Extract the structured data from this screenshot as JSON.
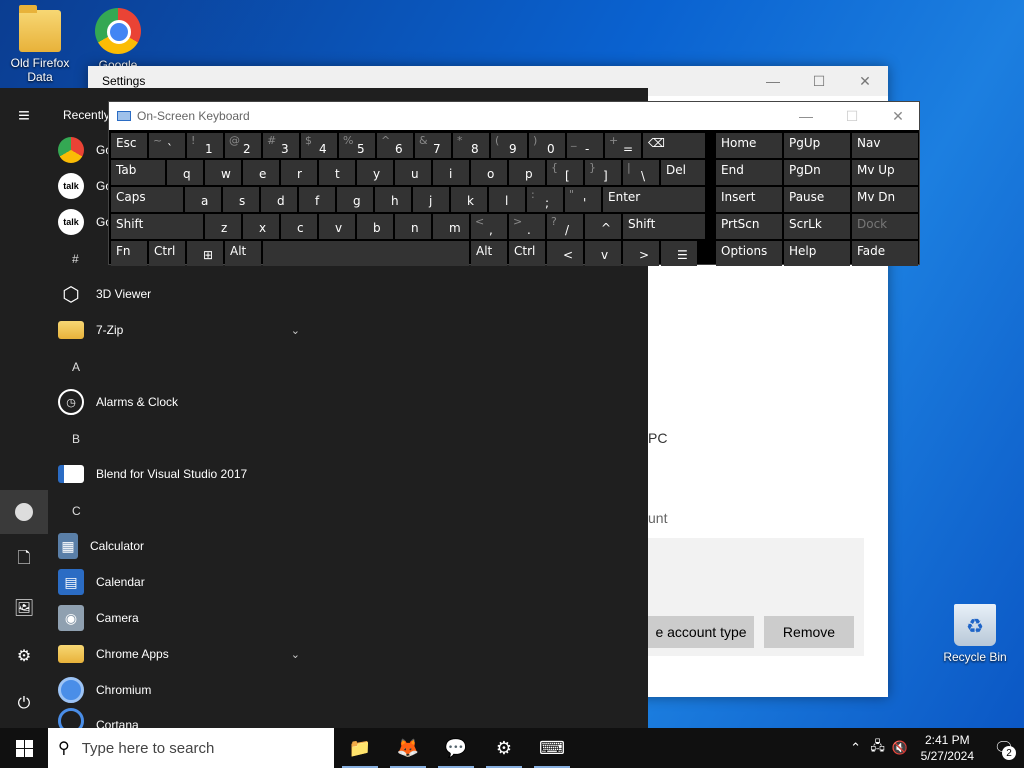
{
  "desktop": {
    "icons": [
      {
        "label": "Old Firefox Data",
        "icon": "folder-icon"
      },
      {
        "label": "Google Chrome",
        "icon": "chrome-icon"
      },
      {
        "label": "Recycle Bin",
        "icon": "recycle-bin-icon"
      }
    ]
  },
  "settings": {
    "title": "Settings",
    "frag_pc": "PC",
    "frag_unt": "unt",
    "change_type_btn": "e account type",
    "remove_btn": "Remove"
  },
  "start_menu": {
    "recently": "Recently",
    "recent_items": [
      {
        "label": "Go",
        "icon": "chrome-icon"
      },
      {
        "label": "Go",
        "icon": "talk-icon"
      },
      {
        "label": "Go",
        "icon": "talk-icon"
      }
    ],
    "letters": [
      "#",
      "A",
      "B",
      "C"
    ],
    "apps": [
      {
        "label": "3D Viewer",
        "icon": "cube-icon"
      },
      {
        "label": "7-Zip",
        "icon": "folder-icon"
      },
      {
        "label": "Alarms & Clock",
        "icon": "alarm-clock-icon"
      },
      {
        "label": "Blend for Visual Studio 2017",
        "icon": "blend-icon"
      },
      {
        "label": "Calculator",
        "icon": "calculator-icon"
      },
      {
        "label": "Calendar",
        "icon": "calendar-icon"
      },
      {
        "label": "Camera",
        "icon": "camera-icon"
      },
      {
        "label": "Chrome Apps",
        "icon": "folder-icon"
      },
      {
        "label": "Chromium",
        "icon": "chromium-icon"
      },
      {
        "label": "Cortana",
        "icon": "cortana-icon"
      }
    ]
  },
  "osk": {
    "title": "On-Screen Keyboard",
    "row1": [
      {
        "sub": "",
        "main": "Esc"
      },
      {
        "sub": "~",
        "main": "`"
      },
      {
        "sub": "!",
        "main": "1"
      },
      {
        "sub": "@",
        "main": "2"
      },
      {
        "sub": "#",
        "main": "3"
      },
      {
        "sub": "$",
        "main": "4"
      },
      {
        "sub": "%",
        "main": "5"
      },
      {
        "sub": "^",
        "main": "6"
      },
      {
        "sub": "&",
        "main": "7"
      },
      {
        "sub": "*",
        "main": "8"
      },
      {
        "sub": "(",
        "main": "9"
      },
      {
        "sub": ")",
        "main": "0"
      },
      {
        "sub": "_",
        "main": "-"
      },
      {
        "sub": "+",
        "main": "="
      },
      {
        "sub": "",
        "main": "⌫"
      }
    ],
    "row2": [
      "Tab",
      "q",
      "w",
      "e",
      "r",
      "t",
      "y",
      "u",
      "i",
      "o",
      "p",
      "[",
      "]",
      "\\",
      "Del"
    ],
    "row2_subs": {
      "[": "{",
      "]": "}",
      "\\": "|"
    },
    "row3": [
      "Caps",
      "a",
      "s",
      "d",
      "f",
      "g",
      "h",
      "j",
      "k",
      "l",
      ";",
      "'",
      "Enter"
    ],
    "row3_subs": {
      ";": ":",
      "'": "\""
    },
    "row4": [
      "Shift",
      "z",
      "x",
      "c",
      "v",
      "b",
      "n",
      "m",
      ",",
      ".",
      "/",
      "^",
      "Shift"
    ],
    "row4_subs": {
      ",": "<",
      ".": ">",
      "/": "?"
    },
    "row5": [
      "Fn",
      "Ctrl",
      "⊞",
      "Alt",
      "",
      "Alt",
      "Ctrl",
      "<",
      "v",
      ">",
      "☰"
    ],
    "nav_keys": [
      [
        "Home",
        "PgUp",
        "Nav"
      ],
      [
        "End",
        "PgDn",
        "Mv Up"
      ],
      [
        "Insert",
        "Pause",
        "Mv Dn"
      ],
      [
        "PrtScn",
        "ScrLk",
        "Dock"
      ],
      [
        "Options",
        "Help",
        "Fade"
      ]
    ]
  },
  "taskbar": {
    "search_placeholder": "Type here to search",
    "apps": [
      {
        "name": "file-explorer-icon",
        "glyph": "📁"
      },
      {
        "name": "firefox-icon",
        "glyph": "🦊"
      },
      {
        "name": "talk-icon",
        "glyph": "💬"
      },
      {
        "name": "settings-gear-icon",
        "glyph": "⚙"
      },
      {
        "name": "osk-icon",
        "glyph": "⌨"
      }
    ],
    "time": "2:41 PM",
    "date": "5/27/2024",
    "notifications": "2"
  }
}
